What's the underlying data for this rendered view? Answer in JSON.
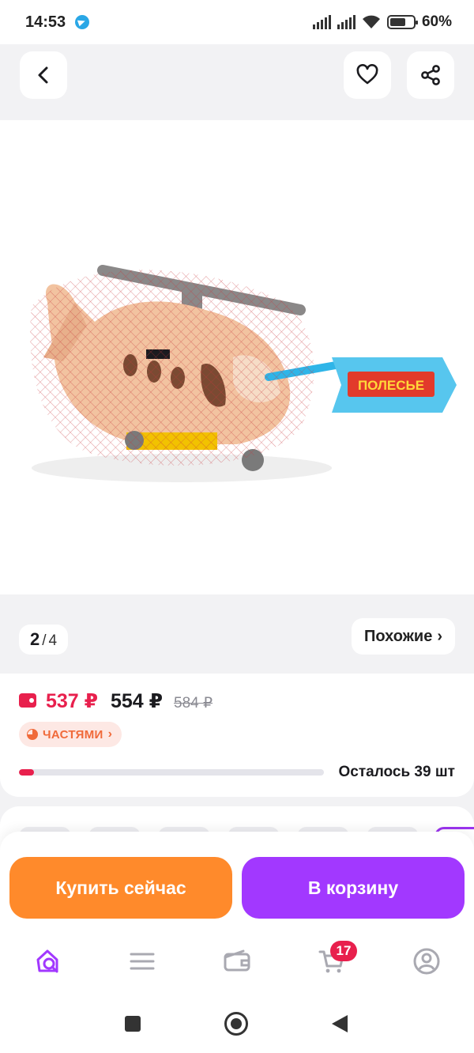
{
  "status_bar": {
    "time": "14:53",
    "battery_percent": "60%",
    "icons": [
      "telegram-icon",
      "signal-icon",
      "signal-icon",
      "wifi-icon",
      "battery-icon"
    ]
  },
  "top_bar": {
    "icons": [
      "back-arrow-icon",
      "heart-icon",
      "share-icon"
    ]
  },
  "gallery": {
    "current": "2",
    "separator": "/",
    "total": "4",
    "similar_label": "Похожие",
    "similar_chevron": "›",
    "product_tag_text": "ПОЛЕСЬЕ"
  },
  "price": {
    "wallet_price": "537 ₽",
    "regular_price": "554 ₽",
    "old_price": "584 ₽",
    "installment_label": "ЧАСТЯМИ",
    "installment_chevron": "›",
    "stock_fraction": 0.05,
    "stock_label": "Осталось 39 шт"
  },
  "actions": {
    "buy_now": "Купить сейчас",
    "add_to_cart": "В корзину"
  },
  "tab_bar": {
    "icons": [
      "home-search-icon",
      "catalog-icon",
      "wallet-icon",
      "cart-icon",
      "profile-icon"
    ],
    "cart_badge": "17"
  },
  "colors": {
    "accent_purple": "#a238ff",
    "buy_orange": "#ff8a2b",
    "price_red": "#e8204d"
  }
}
